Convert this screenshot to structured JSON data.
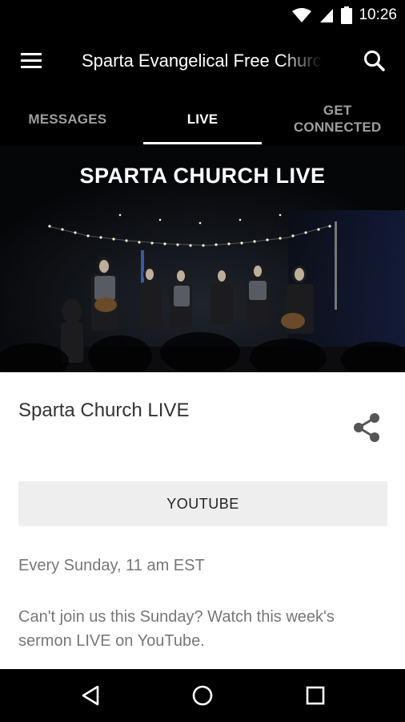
{
  "status_bar": {
    "time": "10:26",
    "icons": [
      "wifi-icon",
      "signal-icon",
      "battery-icon"
    ]
  },
  "app_bar": {
    "title": "Sparta Evangelical Free Church",
    "menu_icon": "menu-icon",
    "search_icon": "search-icon"
  },
  "tabs": [
    {
      "label": "MESSAGES",
      "active": false
    },
    {
      "label": "LIVE",
      "active": true
    },
    {
      "label": "GET CONNECTED",
      "active": false
    }
  ],
  "hero": {
    "title": "SPARTA CHURCH LIVE"
  },
  "content": {
    "title": "Sparta Church LIVE",
    "share_icon": "share-icon",
    "button_label": "YOUTUBE",
    "schedule": "Every Sunday, 11 am EST",
    "description": "Can't join us this Sunday? Watch this week's sermon LIVE on YouTube."
  },
  "nav_bar": {
    "icons": [
      "back-icon",
      "home-icon",
      "recents-icon"
    ]
  },
  "colors": {
    "bar_background": "#000000",
    "tab_inactive": "#9e9e9e",
    "tab_active": "#ffffff",
    "button_background": "#eeeeee",
    "secondary_text": "#777777"
  }
}
